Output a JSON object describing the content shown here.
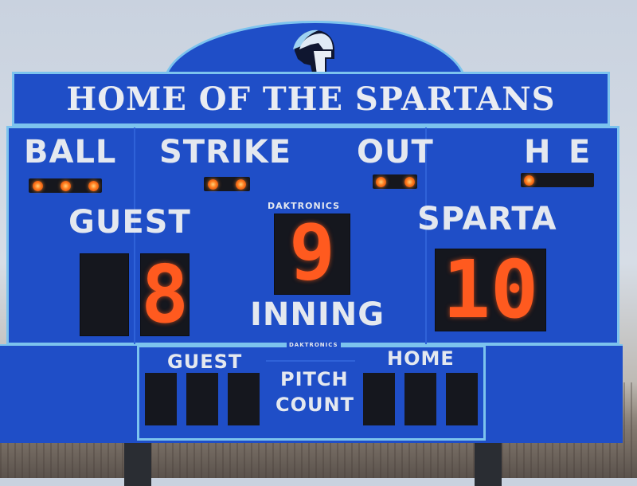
{
  "scoreboard": {
    "banner": "HOME OF THE SPARTANS",
    "labels": {
      "ball": "BALL",
      "strike": "STRIKE",
      "out": "OUT",
      "h": "H",
      "e": "E",
      "guest": "GUEST",
      "home_team": "SPARTA",
      "inning": "INNING",
      "brand": "DAKTRONICS",
      "brand_small": "DAKTRONICS"
    },
    "values": {
      "guest_score": "8",
      "home_score": "10",
      "inning": "9"
    },
    "lit_lights": {
      "ball": 3,
      "strike": 2,
      "out": 2,
      "h_e": 1
    },
    "pitch_count": {
      "guest_label": "GUEST",
      "home_label": "HOME",
      "center_label_1": "PITCH",
      "center_label_2": "COUNT"
    },
    "colors": {
      "panel_blue": "#1f4ec7",
      "trim_light_blue": "#7cc3ee",
      "led_orange": "#ff5a1f",
      "text_white": "#e4e8ef"
    },
    "icons": [
      "spartan-helmet-icon"
    ]
  }
}
